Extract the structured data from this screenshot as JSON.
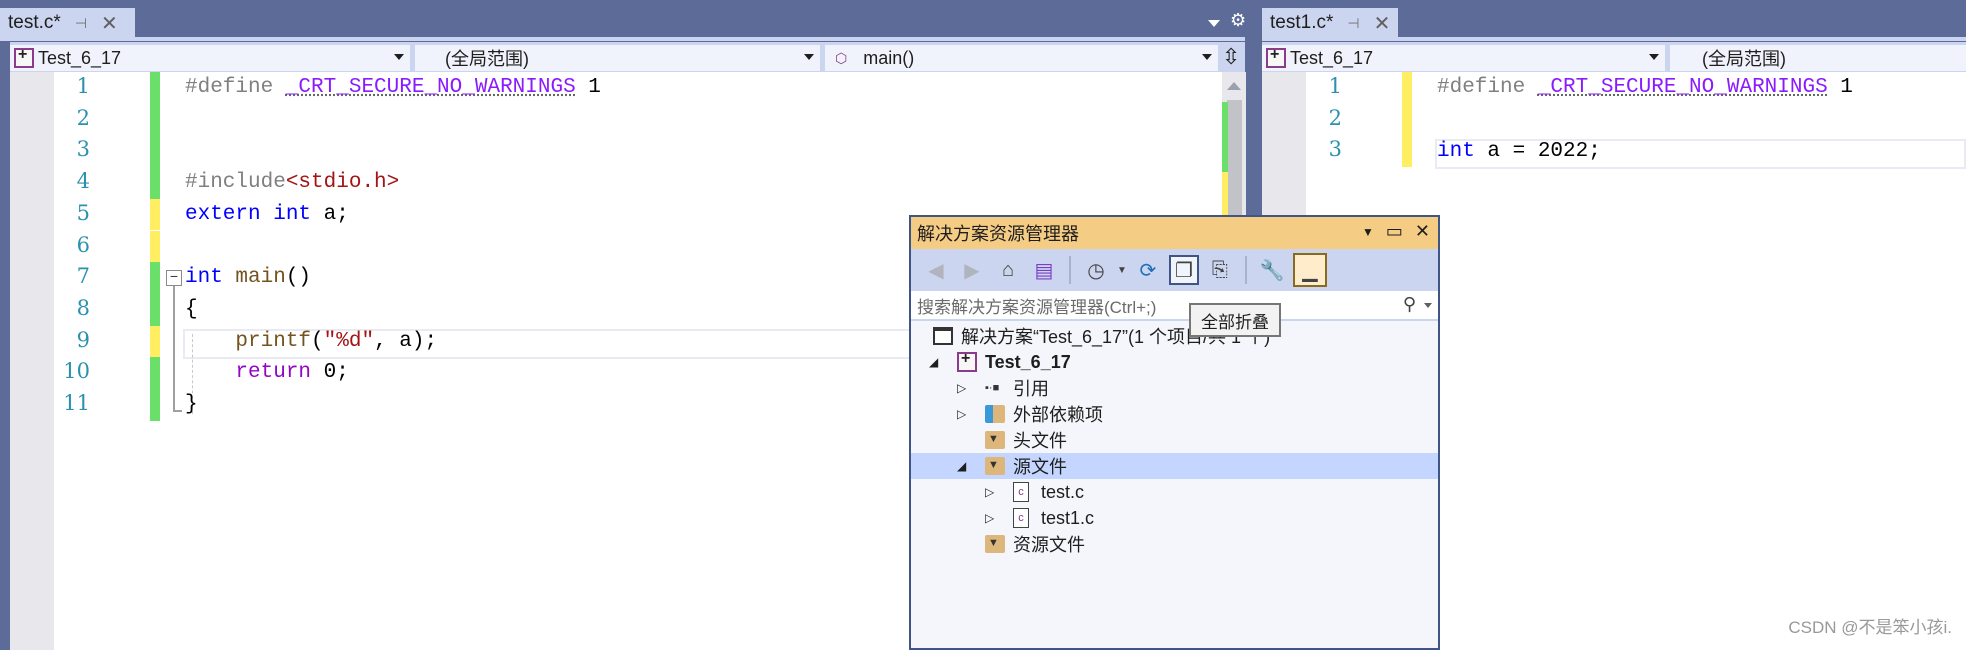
{
  "left_editor": {
    "tab": {
      "label": "test.c*",
      "pin_icon": "pin-icon",
      "close_icon": "close-icon"
    },
    "project_dropdown": "Test_6_17",
    "scope_dropdown": "(全局范围)",
    "member_dropdown": "main()",
    "lines": [
      {
        "n": "1",
        "change": "saved"
      },
      {
        "n": "2",
        "change": "saved"
      },
      {
        "n": "3",
        "change": "saved"
      },
      {
        "n": "4",
        "change": "saved"
      },
      {
        "n": "5",
        "change": "unsaved"
      },
      {
        "n": "6",
        "change": "unsaved"
      },
      {
        "n": "7",
        "change": "saved"
      },
      {
        "n": "8",
        "change": "saved"
      },
      {
        "n": "9",
        "change": "unsaved"
      },
      {
        "n": "10",
        "change": "saved"
      },
      {
        "n": "11",
        "change": "saved"
      }
    ],
    "code": {
      "l1_pp": "#define ",
      "l1_macro": "_CRT_SECURE_NO_WARNINGS",
      "l1_val": " 1",
      "l4_pp": "#include",
      "l4_inc": "<stdio.h>",
      "l5_kw1": "extern",
      "l5_kw2": " int",
      "l5_rest": " a;",
      "l7_kw": "int",
      "l7_fn": " main",
      "l7_rest": "()",
      "l8": "{",
      "l9_fn": "    printf",
      "l9_p": "(",
      "l9_str": "\"%d\"",
      "l9_rest": ", a);",
      "l10_kw": "    return",
      "l10_rest": " 0;",
      "l11": "}"
    }
  },
  "right_editor": {
    "tab": {
      "label": "test1.c*",
      "pin_icon": "pin-icon",
      "close_icon": "close-icon"
    },
    "project_dropdown": "Test_6_17",
    "scope_dropdown": "(全局范围)",
    "lines": [
      {
        "n": "1",
        "change": "unsaved"
      },
      {
        "n": "2",
        "change": "unsaved"
      },
      {
        "n": "3",
        "change": "unsaved"
      }
    ],
    "code": {
      "l1_pp": "#define ",
      "l1_macro": "_CRT_SECURE_NO_WARNINGS",
      "l1_val": " 1",
      "l3_kw": "int",
      "l3_rest": " a = 2022;"
    }
  },
  "solution_explorer": {
    "title": "解决方案资源管理器",
    "search_placeholder": "搜索解决方案资源管理器(Ctrl+;)",
    "tooltip": "全部折叠",
    "tree": [
      {
        "label": "解决方案“Test_6_17”(1 个项目/共 1 个)",
        "icon": "solution-icon",
        "bold": false
      },
      {
        "label": "Test_6_17",
        "icon": "project-icon",
        "bold": true,
        "expanded": true
      },
      {
        "label": "引用",
        "icon": "references-icon",
        "expanded": false
      },
      {
        "label": "外部依赖项",
        "icon": "external-deps-icon",
        "expanded": false
      },
      {
        "label": "头文件",
        "icon": "filter-folder-icon"
      },
      {
        "label": "源文件",
        "icon": "filter-folder-icon",
        "expanded": true,
        "selected": true
      },
      {
        "label": "test.c",
        "icon": "c-file-icon",
        "expanded": false
      },
      {
        "label": "test1.c",
        "icon": "c-file-icon",
        "expanded": false
      },
      {
        "label": "资源文件",
        "icon": "filter-folder-icon"
      }
    ]
  },
  "colors": {
    "chrome": "#5d6b99",
    "tab_active": "#ccd5f0",
    "change_saved": "#6ae06a",
    "change_unsaved": "#ffee62",
    "panel_title": "#f5cc84",
    "selection": "#c4d5ff"
  },
  "watermark": "CSDN @不是笨小孩i."
}
